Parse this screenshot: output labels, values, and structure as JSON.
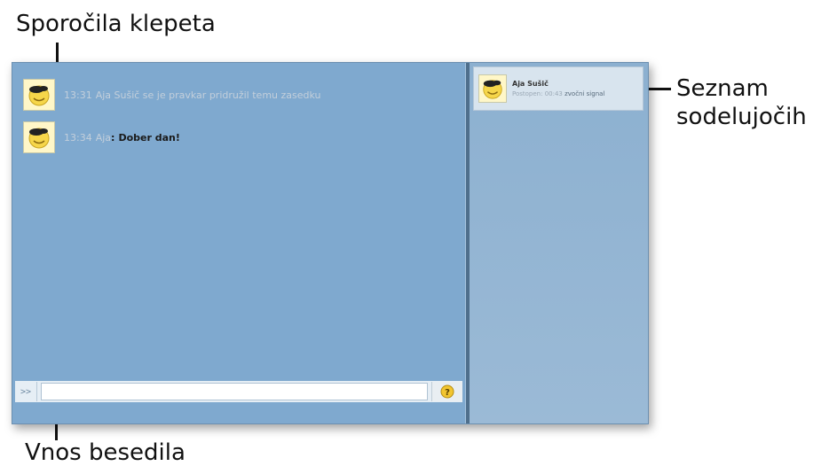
{
  "callouts": {
    "messages": "Sporočila klepeta",
    "participants_line1": "Seznam",
    "participants_line2": "sodelujočih",
    "input": "Vnos besedila"
  },
  "messages": [
    {
      "time": "13:31",
      "system_text": "Aja Sušič se je pravkar pridružil temu zasedku",
      "avatar_icon": "smiley-icon"
    },
    {
      "time": "13:34",
      "author": "Aja",
      "separator": ":",
      "text": "Dober dan!",
      "avatar_icon": "smiley-icon"
    }
  ],
  "input_bar": {
    "prefix": ">>",
    "value": "",
    "help_icon": "help-icon"
  },
  "participants": [
    {
      "name": "Aja Sušič",
      "status": "Postopen: 00:43",
      "signal": "zvočni signal",
      "avatar_icon": "smiley-icon"
    }
  ],
  "colors": {
    "pane": "#7fa9cf",
    "participants_pane": "#8cb0d0",
    "divider": "#4f6f8c"
  }
}
